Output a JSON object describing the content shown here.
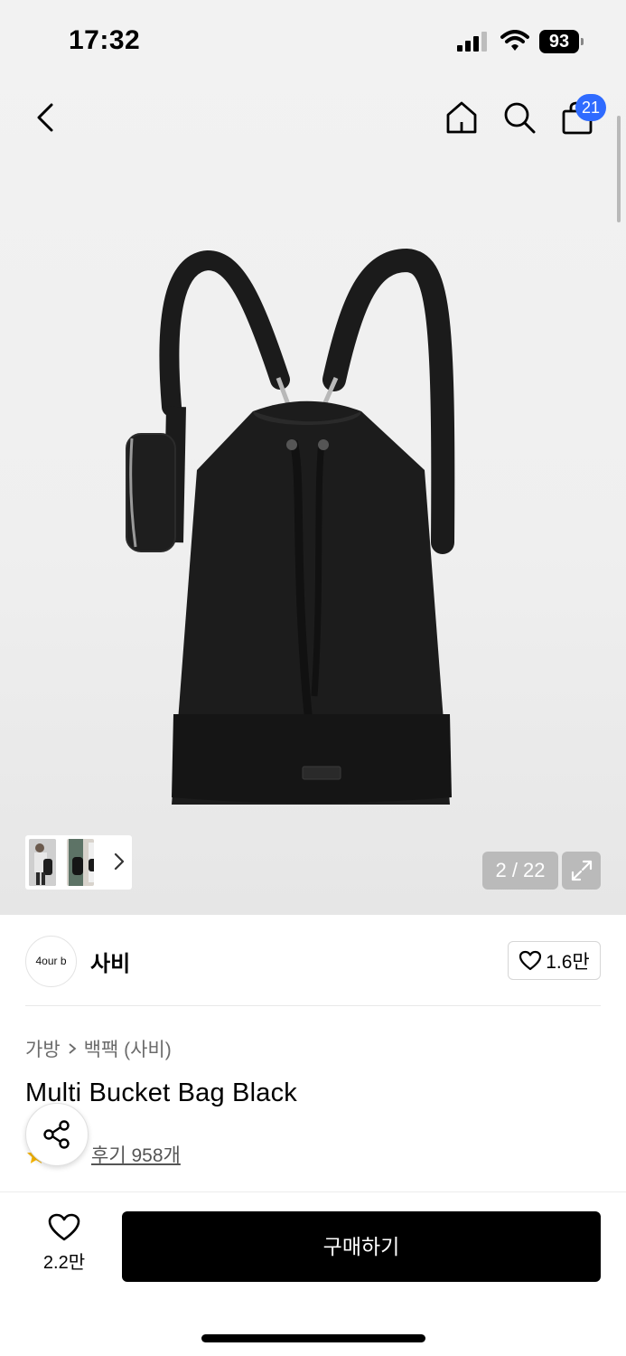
{
  "status_bar": {
    "time": "17:32",
    "battery": "93"
  },
  "nav": {
    "cart_count": "21"
  },
  "gallery": {
    "page_indicator": "2 / 22",
    "current_page": 2,
    "total_pages": 22
  },
  "brand": {
    "logo_text": "4our b",
    "name": "사비",
    "like_count": "1.6만"
  },
  "product": {
    "breadcrumb": [
      "가방",
      "백팩 (사비)"
    ],
    "title": "Multi Bucket Bag Black",
    "review_link": "후기 958개"
  },
  "bottom_bar": {
    "wish_count": "2.2만",
    "buy_label": "구매하기"
  },
  "colors": {
    "badge": "#2f6bff",
    "buy_button": "#000000",
    "star": "#f5b400"
  }
}
